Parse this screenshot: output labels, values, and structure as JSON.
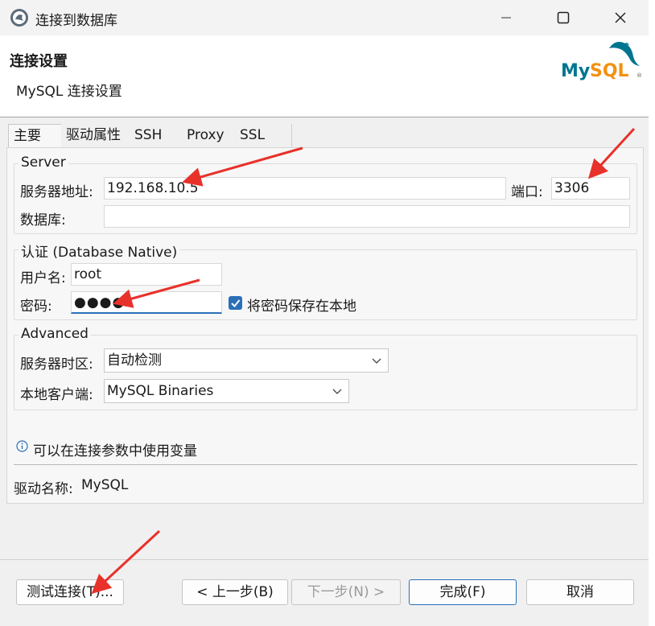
{
  "window": {
    "title": "连接到数据库",
    "minimize_icon": "minimize-icon",
    "maximize_icon": "maximize-icon",
    "close_icon": "close-icon"
  },
  "header": {
    "title": "连接设置",
    "subtitle": "MySQL 连接设置",
    "logo_text": "MySQL",
    "logo_reg": "®"
  },
  "tabs": [
    "主要",
    "驱动属性",
    "SSH",
    "Proxy",
    "SSL"
  ],
  "server": {
    "legend": "Server",
    "host_label": "服务器地址:",
    "host_value": "192.168.10.5",
    "port_label": "端口:",
    "port_value": "3306",
    "db_label": "数据库:",
    "db_value": ""
  },
  "auth": {
    "legend": "认证 (Database Native)",
    "user_label": "用户名:",
    "user_value": "root",
    "password_label": "密码:",
    "password_value": "●●●●",
    "save_password_label": "将密码保存在本地",
    "save_password_checked": true
  },
  "advanced": {
    "legend": "Advanced",
    "timezone_label": "服务器时区:",
    "timezone_value": "自动检测",
    "client_label": "本地客户端:",
    "client_value": "MySQL Binaries"
  },
  "info": {
    "icon": "info-icon",
    "text": "可以在连接参数中使用变量"
  },
  "driver": {
    "label": "驱动名称:",
    "value": "MySQL"
  },
  "buttons": {
    "test": "测试连接(T)...",
    "back": "< 上一步(B)",
    "next": "下一步(N) >",
    "finish": "完成(F)",
    "cancel": "取消"
  },
  "colors": {
    "accent": "#2b6fb8",
    "arrow": "#e8312a",
    "mysql_teal": "#00758f",
    "mysql_orange": "#f29111"
  }
}
